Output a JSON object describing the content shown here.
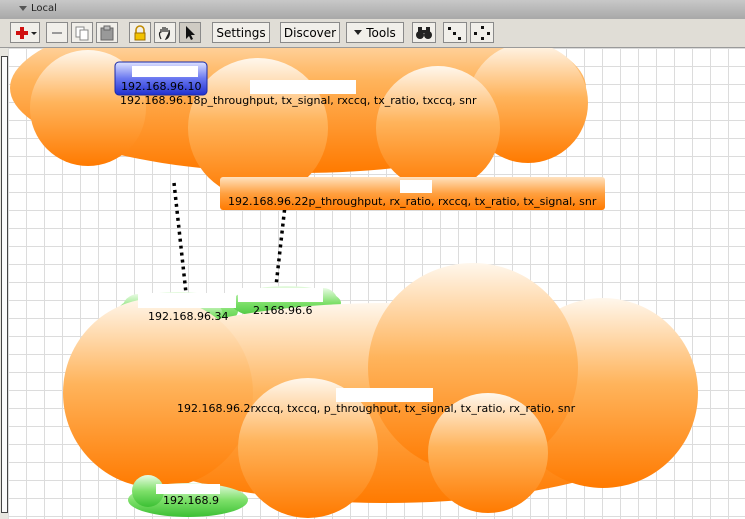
{
  "window": {
    "title": "Local"
  },
  "toolbar": {
    "settings_label": "Settings",
    "discover_label": "Discover",
    "tools_label": "Tools",
    "icons": [
      "add-icon",
      "remove-icon",
      "copy-icon",
      "paste-icon",
      "lock-icon",
      "hand-icon",
      "pointer-icon",
      "binoculars-icon",
      "autolayout-icon",
      "layout-circle-icon"
    ]
  },
  "map": {
    "nodes": [
      {
        "id": "top-cloud",
        "label": "192.168.96.18p_throughput, tx_signal, rxccq, tx_ratio, txccq, snr"
      },
      {
        "id": "selected-node",
        "label": "192.168.96.10"
      },
      {
        "id": "middle-node",
        "label": "192.168.96.22p_throughput, rx_ratio, rxccq, tx_ratio, tx_signal, snr"
      },
      {
        "id": "green-node-1",
        "label": "192.168.96.34"
      },
      {
        "id": "green-node-2",
        "label": "2.168.96.6"
      },
      {
        "id": "big-cloud",
        "label": "192.168.96.2rxccq, txccq, p_throughput, tx_signal, tx_ratio, rx_ratio, snr"
      },
      {
        "id": "green-node-3",
        "label": "192.168.9"
      }
    ],
    "colors": {
      "orange": "#ff8a1a",
      "green": "#55d04a",
      "blue": "#3a4fe0",
      "grid": "#dcdcdc"
    }
  }
}
